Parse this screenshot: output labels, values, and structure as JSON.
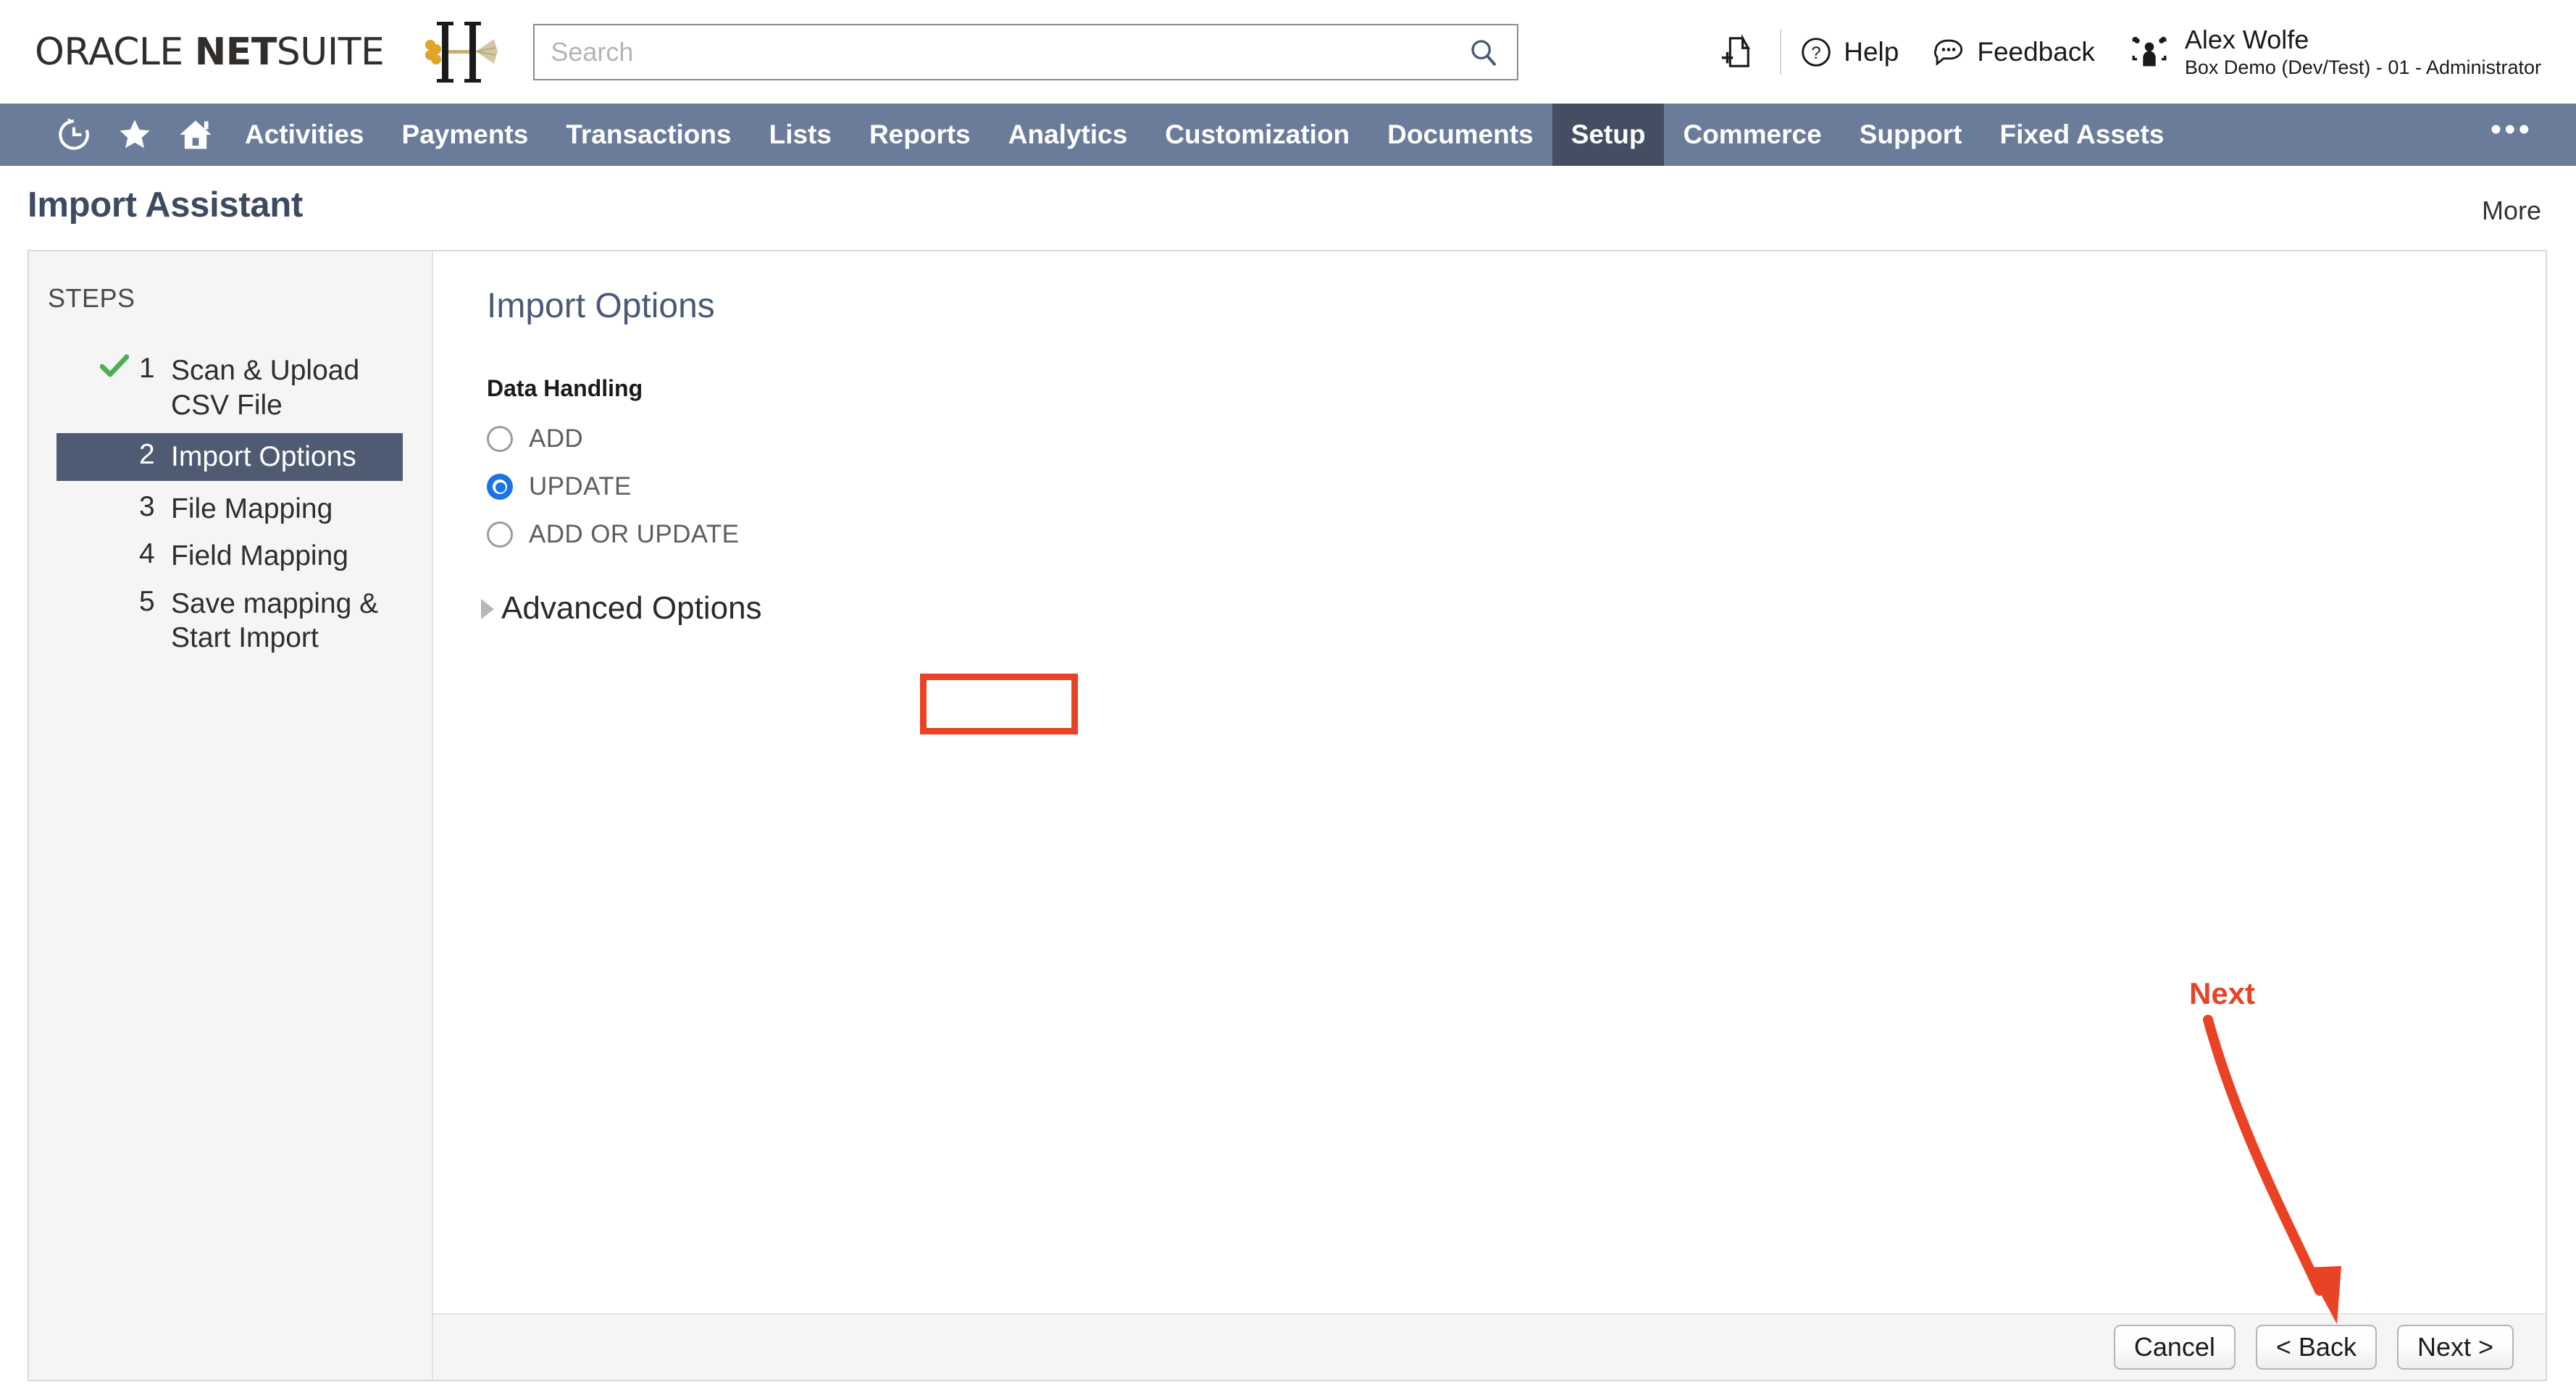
{
  "topbar": {
    "brand_oracle": "ORACLE",
    "brand_net": "NET",
    "brand_suite": "SUITE",
    "search_placeholder": "Search",
    "search_value": "",
    "search_icon": "search-icon",
    "add_page_icon": "add-page-icon",
    "help_label": "Help",
    "help_icon": "help-circle-icon",
    "feedback_label": "Feedback",
    "feedback_icon": "speech-bubble-icon",
    "user_icon": "users-group-icon",
    "user_name": "Alex Wolfe",
    "user_role": "Box Demo (Dev/Test) - 01 - Administrator"
  },
  "nav": {
    "icons": [
      "recent-history-icon",
      "star-favorites-icon",
      "home-icon"
    ],
    "items": [
      {
        "label": "Activities",
        "active": false
      },
      {
        "label": "Payments",
        "active": false
      },
      {
        "label": "Transactions",
        "active": false
      },
      {
        "label": "Lists",
        "active": false
      },
      {
        "label": "Reports",
        "active": false
      },
      {
        "label": "Analytics",
        "active": false
      },
      {
        "label": "Customization",
        "active": false
      },
      {
        "label": "Documents",
        "active": false
      },
      {
        "label": "Setup",
        "active": true
      },
      {
        "label": "Commerce",
        "active": false
      },
      {
        "label": "Support",
        "active": false
      },
      {
        "label": "Fixed Assets",
        "active": false
      }
    ],
    "overflow": "•••",
    "active_bg": "#434e62",
    "bar_bg": "#6b7b9a"
  },
  "page": {
    "title": "Import Assistant",
    "more_label": "More"
  },
  "sidebar": {
    "heading": "STEPS",
    "steps": [
      {
        "num": "1",
        "label": "Scan & Upload CSV File",
        "complete": true,
        "active": false
      },
      {
        "num": "2",
        "label": "Import Options",
        "complete": false,
        "active": true
      },
      {
        "num": "3",
        "label": "File Mapping",
        "complete": false,
        "active": false
      },
      {
        "num": "4",
        "label": "Field Mapping",
        "complete": false,
        "active": false
      },
      {
        "num": "5",
        "label": "Save mapping & Start Import",
        "complete": false,
        "active": false
      }
    ],
    "check_color": "#4caf50",
    "active_bg": "#4f5b72"
  },
  "main": {
    "title": "Import Options",
    "data_handling_label": "Data Handling",
    "options": [
      {
        "label": "ADD",
        "selected": false
      },
      {
        "label": "UPDATE",
        "selected": true
      },
      {
        "label": "ADD OR UPDATE",
        "selected": false
      }
    ],
    "selected_option": "UPDATE",
    "radio_color": "#1a73e8",
    "advanced_options_label": "Advanced Options",
    "advanced_expanded": false,
    "advanced_icon": "triangle-right-icon"
  },
  "footer": {
    "cancel_label": "Cancel",
    "back_label": "< Back",
    "next_label": "Next >"
  },
  "annotations": {
    "highlight_target": "UPDATE",
    "highlight_color": "#ea4224",
    "next_callout_label": "Next",
    "next_callout_color": "#ea4224",
    "arrow_icon": "red-arrow-icon"
  }
}
